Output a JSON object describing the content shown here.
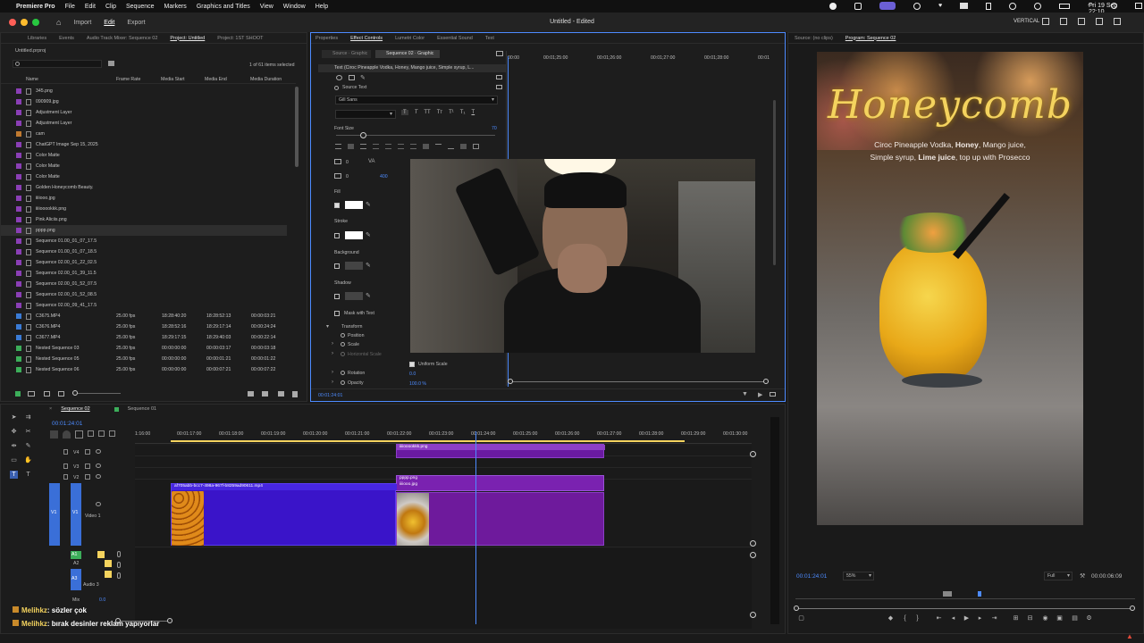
{
  "menubar": {
    "app": "Premiere Pro",
    "items": [
      "File",
      "Edit",
      "Clip",
      "Sequence",
      "Markers",
      "Graphics and Titles",
      "View",
      "Window",
      "Help"
    ],
    "datetime": "Fri 19 Sep  22:10"
  },
  "titlebar": {
    "tabs": [
      "Import",
      "Edit",
      "Export"
    ],
    "active_tab": "Edit",
    "title": "Untitled - Edited",
    "workspace": "VERTICAL"
  },
  "project_panel": {
    "tabs": [
      "Libraries",
      "Events",
      "Audio Track Mixer: Sequence 02",
      "Project: Untitled",
      "Project: 1ST SHOOT"
    ],
    "active_tab": "Project: Untitled",
    "project_file": "Untitled.prproj",
    "items_selected": "1 of 61 items selected",
    "columns": [
      "Name",
      "Frame Rate",
      "Media Start",
      "Media End",
      "Media Duration"
    ],
    "rows": [
      {
        "name": "345.png",
        "fps": "",
        "start": "",
        "end": "",
        "dur": "",
        "color": "#8a3fb5"
      },
      {
        "name": "090909.jpg",
        "fps": "",
        "start": "",
        "end": "",
        "dur": "",
        "color": "#8a3fb5"
      },
      {
        "name": "Adjustment Layer",
        "fps": "",
        "start": "",
        "end": "",
        "dur": "",
        "color": "#8a3fb5"
      },
      {
        "name": "Adjustment Layer",
        "fps": "",
        "start": "",
        "end": "",
        "dur": "",
        "color": "#8a3fb5"
      },
      {
        "name": "cam",
        "fps": "",
        "start": "",
        "end": "",
        "dur": "",
        "color": "#c07a30"
      },
      {
        "name": "ChatGPT Image Sep 15, 2025",
        "fps": "",
        "start": "",
        "end": "",
        "dur": "",
        "color": "#8a3fb5"
      },
      {
        "name": "Color Matte",
        "fps": "",
        "start": "",
        "end": "",
        "dur": "",
        "color": "#8a3fb5"
      },
      {
        "name": "Color Matte",
        "fps": "",
        "start": "",
        "end": "",
        "dur": "",
        "color": "#8a3fb5"
      },
      {
        "name": "Color Matte",
        "fps": "",
        "start": "",
        "end": "",
        "dur": "",
        "color": "#8a3fb5"
      },
      {
        "name": "Golden Honeycomb Beauty.",
        "fps": "",
        "start": "",
        "end": "",
        "dur": "",
        "color": "#8a3fb5"
      },
      {
        "name": "iiiiooo.jpg",
        "fps": "",
        "start": "",
        "end": "",
        "dur": "",
        "color": "#8a3fb5"
      },
      {
        "name": "iiiiooookkk.png",
        "fps": "",
        "start": "",
        "end": "",
        "dur": "",
        "color": "#8a3fb5"
      },
      {
        "name": "Pink Aliciis.png",
        "fps": "",
        "start": "",
        "end": "",
        "dur": "",
        "color": "#8a3fb5"
      },
      {
        "name": "pppp.png",
        "fps": "",
        "start": "",
        "end": "",
        "dur": "",
        "color": "#8a3fb5"
      },
      {
        "name": "Sequence 01.00_01_07_17.5",
        "fps": "",
        "start": "",
        "end": "",
        "dur": "",
        "color": "#8a3fb5"
      },
      {
        "name": "Sequence 01.00_01_07_18.5",
        "fps": "",
        "start": "",
        "end": "",
        "dur": "",
        "color": "#8a3fb5"
      },
      {
        "name": "Sequence 02.00_01_22_02.5",
        "fps": "",
        "start": "",
        "end": "",
        "dur": "",
        "color": "#8a3fb5"
      },
      {
        "name": "Sequence 02.00_01_39_11.5",
        "fps": "",
        "start": "",
        "end": "",
        "dur": "",
        "color": "#8a3fb5"
      },
      {
        "name": "Sequence 02.00_01_52_07.5",
        "fps": "",
        "start": "",
        "end": "",
        "dur": "",
        "color": "#8a3fb5"
      },
      {
        "name": "Sequence 02.00_01_52_08.5",
        "fps": "",
        "start": "",
        "end": "",
        "dur": "",
        "color": "#8a3fb5"
      },
      {
        "name": "Sequence 02.00_09_41_17.5",
        "fps": "",
        "start": "",
        "end": "",
        "dur": "",
        "color": "#8a3fb5"
      },
      {
        "name": "C3675.MP4",
        "fps": "25.00 fps",
        "start": "18:28:40:20",
        "end": "18:28:52:13",
        "dur": "00:00:03:21",
        "color": "#3a7bd5"
      },
      {
        "name": "C3676.MP4",
        "fps": "25.00 fps",
        "start": "18:28:52:16",
        "end": "18:29:17:14",
        "dur": "00:00:24:24",
        "color": "#3a7bd5"
      },
      {
        "name": "C3677.MP4",
        "fps": "25.00 fps",
        "start": "18:29:17:15",
        "end": "18:29:40:03",
        "dur": "00:00:22:14",
        "color": "#3a7bd5"
      },
      {
        "name": "Nested Sequence 03",
        "fps": "25.00 fps",
        "start": "00:00:00:00",
        "end": "00:00:03:17",
        "dur": "00:00:03:18",
        "color": "#3cae5a"
      },
      {
        "name": "Nested Sequence 05",
        "fps": "25.00 fps",
        "start": "00:00:00:00",
        "end": "00:00:01:21",
        "dur": "00:00:01:22",
        "color": "#3cae5a"
      },
      {
        "name": "Nested Sequence 06",
        "fps": "25.00 fps",
        "start": "00:00:00:00",
        "end": "00:00:07:21",
        "dur": "00:00:07:22",
        "color": "#3cae5a"
      }
    ]
  },
  "effect_controls": {
    "tabs": [
      "Properties",
      "Effect Controls",
      "Lumetri Color",
      "Essential Sound",
      "Text"
    ],
    "active_tab": "Effect Controls",
    "source_label": "Source · Graphic",
    "sequence_label": "Sequence 02 · Graphic",
    "text_layer": "Text (Ciroc Pineapple Vodka, Honey, Mango juice, Simple syrup, L...",
    "source_text": "Source Text",
    "font": "Gill Sans",
    "font_size_label": "Font Size",
    "font_size": "70",
    "tracking_value": "0",
    "leading_value": "400",
    "fill_label": "Fill",
    "stroke_label": "Stroke",
    "background_label": "Background",
    "shadow_label": "Shadow",
    "mask_label": "Mask with Text",
    "transform_label": "Transform",
    "position_label": "Position",
    "scale_label": "Scale",
    "hscale_label": "Horizontal Scale",
    "uniform_label": "Uniform Scale",
    "rotation_label": "Rotation",
    "rotation_value": "0.0",
    "opacity_label": "Opacity",
    "opacity_value": "100.0 %",
    "timecode": "00:01:24:01",
    "ruler": [
      "00:00",
      "00:01;25:00",
      "00:01;26:00",
      "00:01;27:00",
      "00:01;28:00",
      "00:01"
    ]
  },
  "source_monitor": {
    "tabs": [
      "Source: (no clips)",
      "Program: Sequence 02"
    ],
    "active_tab": "Program: Sequence 02"
  },
  "program_monitor": {
    "title_art": "Honeycomb",
    "caption_line1_pre": "Ciroc Pineapple Vodka, ",
    "caption_line1_bold": "Honey",
    "caption_line1_post": ", Mango juice,",
    "caption_line2_pre": "Simple syrup, ",
    "caption_line2_bold": "Lime juice",
    "caption_line2_post": ", top up with Prosecco",
    "timecode": "00:01:24:01",
    "zoom": "55%",
    "quality": "Full",
    "duration": "00:00:06:09"
  },
  "timeline": {
    "tabs": [
      "Sequence 02",
      "Sequence 01"
    ],
    "active_tab": "Sequence 02",
    "timecode": "00:01:24:01",
    "ruler": [
      "1:16:00",
      "00:01:17:00",
      "00:01:18:00",
      "00:01:19:00",
      "00:01:20:00",
      "00:01:21:00",
      "00:01:22:00",
      "00:01:23:00",
      "00:01:24:00",
      "00:01:25:00",
      "00:01:26:00",
      "00:01:27:00",
      "00:01:28:00",
      "00:01:29:00",
      "00:01:30:00"
    ],
    "video_tracks": [
      "V4",
      "V3",
      "V2",
      "V1"
    ],
    "video_track_name": "Video 1",
    "audio_tracks": [
      "A1",
      "A2",
      "A3"
    ],
    "audio_track_name": "Audio 3",
    "mix_label": "Mix",
    "mix_value": "0.0",
    "clips": {
      "v4": "iiiiooookkk.png",
      "v2": "pppp.png",
      "v1_main": "af705abb-bcc7-498a-967f-b8259ad90611.mp4",
      "v1_second": "iiiiooo.jpg"
    }
  },
  "chat_overlay": [
    {
      "user": "Melihkz",
      "message": "sözler çok"
    },
    {
      "user": "Melihkz",
      "message": "bırak desinler reklam yapıyorlar"
    }
  ],
  "colors": {
    "accent": "#4d8bff",
    "clip_blue": "#3a14c9",
    "clip_purple": "#6e1a9c",
    "chat_user": "#f4d35e"
  }
}
